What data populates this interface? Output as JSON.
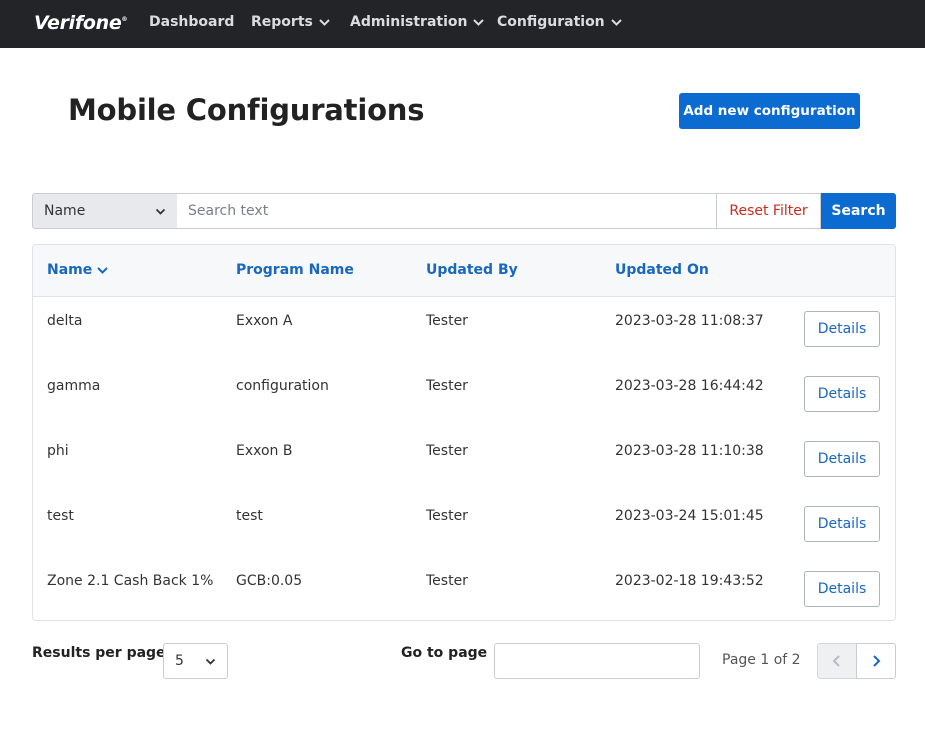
{
  "brand": {
    "logo_text": "Verifone",
    "logo_mark": "®"
  },
  "nav": {
    "items": [
      {
        "label": "Dashboard",
        "has_dropdown": false
      },
      {
        "label": "Reports",
        "has_dropdown": true
      },
      {
        "label": "Administration",
        "has_dropdown": true
      },
      {
        "label": "Configuration",
        "has_dropdown": true
      }
    ]
  },
  "page": {
    "title": "Mobile Configurations",
    "add_button_label": "Add new configuration"
  },
  "filter": {
    "field_selected": "Name",
    "search_placeholder": "Search text",
    "search_value": "",
    "reset_label": "Reset Filter",
    "search_label": "Search"
  },
  "table": {
    "columns": [
      {
        "label": "Name",
        "sorted": "desc"
      },
      {
        "label": "Program Name"
      },
      {
        "label": "Updated By"
      },
      {
        "label": "Updated On"
      }
    ],
    "details_label": "Details",
    "rows": [
      {
        "name": "delta",
        "program": "Exxon A",
        "updated_by": "Tester",
        "updated_on": "2023-03-28 11:08:37"
      },
      {
        "name": "gamma",
        "program": "configuration",
        "updated_by": "Tester",
        "updated_on": "2023-03-28 16:44:42"
      },
      {
        "name": "phi",
        "program": "Exxon B",
        "updated_by": "Tester",
        "updated_on": "2023-03-28 11:10:38"
      },
      {
        "name": "test",
        "program": "test",
        "updated_by": "Tester",
        "updated_on": "2023-03-24 15:01:45"
      },
      {
        "name": "Zone 2.1 Cash Back 1%",
        "program": "GCB:0.05",
        "updated_by": "Tester",
        "updated_on": "2023-02-18 19:43:52"
      }
    ]
  },
  "pagination": {
    "results_per_page_label": "Results per page",
    "results_per_page_value": "5",
    "goto_label": "Go to page",
    "goto_value": "",
    "page_info": "Page 1 of 2"
  },
  "colors": {
    "nav_bg": "#222427",
    "primary": "#0b6bd1",
    "link": "#1867c0",
    "danger": "#c92b1f"
  }
}
